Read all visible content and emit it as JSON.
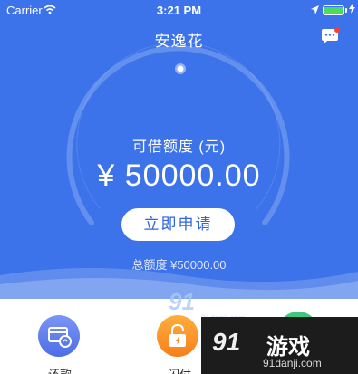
{
  "status_bar": {
    "carrier": "Carrier",
    "time": "3:21 PM"
  },
  "nav": {
    "title": "安逸花"
  },
  "credit": {
    "label": "可借额度 (元)",
    "amount": "¥ 50000.00",
    "apply_button": "立即申请",
    "total_limit": "总额度 ¥50000.00"
  },
  "features": [
    {
      "label": "还款",
      "icon": "card-repay-icon",
      "color": "#5a7ceb"
    },
    {
      "label": "闪付",
      "icon": "lock-icon",
      "color": "#f7901e"
    },
    {
      "label": "",
      "icon": "green-circle-icon",
      "color": "#3fc67f"
    }
  ],
  "watermark": {
    "number": "91",
    "text": "游戏",
    "domain": "91danji.com"
  },
  "colors": {
    "hero_blue": "#3c73ea",
    "accent_blue": "#2f66e0"
  }
}
